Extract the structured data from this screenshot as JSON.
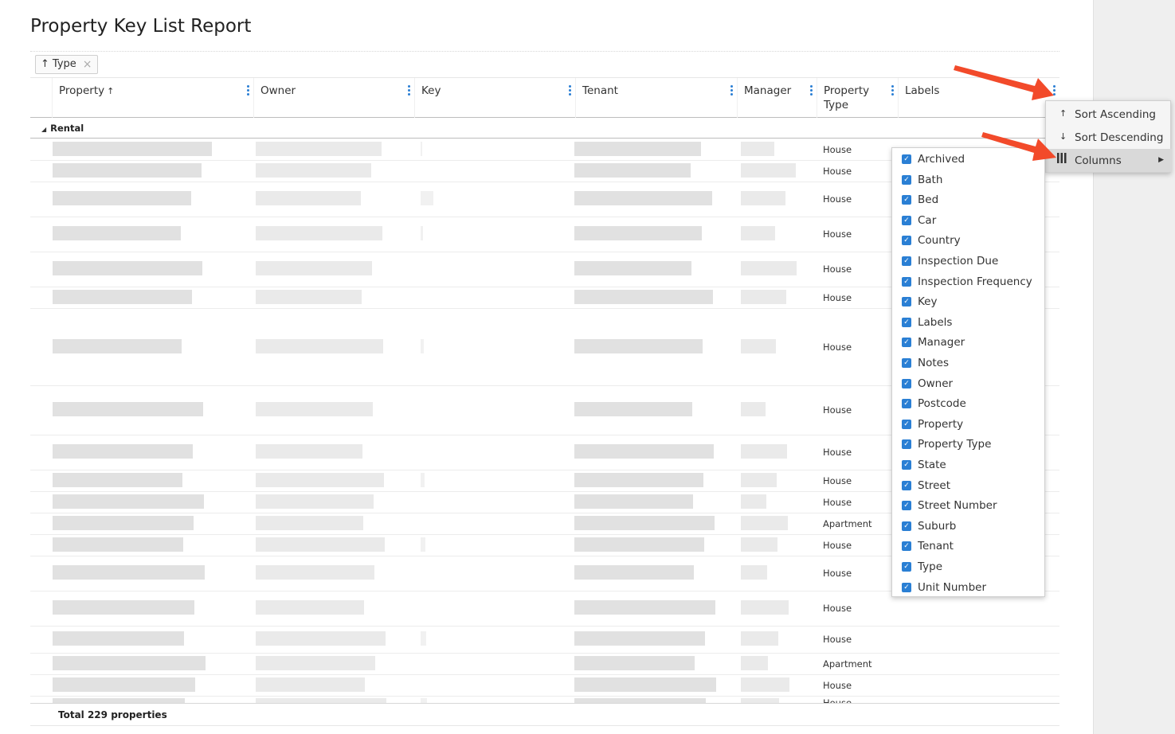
{
  "page": {
    "title": "Property Key List Report"
  },
  "filter": {
    "arrow": "↑",
    "label": "Type",
    "remove": "×"
  },
  "columns": [
    {
      "label": "Property",
      "sorted": "↑"
    },
    {
      "label": "Owner"
    },
    {
      "label": "Key"
    },
    {
      "label": "Tenant"
    },
    {
      "label": "Manager"
    },
    {
      "label": "Property Type"
    },
    {
      "label": "Labels"
    }
  ],
  "group": {
    "label": "Rental"
  },
  "rows": [
    {
      "type": "House"
    },
    {
      "type": "House"
    },
    {
      "type": "House"
    },
    {
      "type": "House"
    },
    {
      "type": "House"
    },
    {
      "type": "House"
    },
    {
      "type": "House"
    },
    {
      "type": "House"
    },
    {
      "type": "House"
    },
    {
      "type": "House"
    },
    {
      "type": "House"
    },
    {
      "type": "Apartment"
    },
    {
      "type": "House"
    },
    {
      "type": "House"
    },
    {
      "type": "House"
    },
    {
      "type": "House"
    },
    {
      "type": "Apartment"
    },
    {
      "type": "House"
    },
    {
      "type": "House"
    }
  ],
  "footer": {
    "total": "Total 229 properties"
  },
  "column_menu": {
    "items": [
      {
        "label": "Sort Ascending",
        "icon": "↑"
      },
      {
        "label": "Sort Descending",
        "icon": "↓"
      },
      {
        "label": "Columns",
        "icon": "columns-icon"
      }
    ]
  },
  "columns_submenu": {
    "items": [
      "Archived",
      "Bath",
      "Bed",
      "Car",
      "Country",
      "Inspection Due",
      "Inspection Frequency",
      "Key",
      "Labels",
      "Manager",
      "Notes",
      "Owner",
      "Postcode",
      "Property",
      "Property Type",
      "State",
      "Street",
      "Street Number",
      "Suburb",
      "Tenant",
      "Type",
      "Unit Number"
    ]
  },
  "colors": {
    "accent": "#2a7fd4",
    "annotation_arrow": "#f24a2a"
  }
}
